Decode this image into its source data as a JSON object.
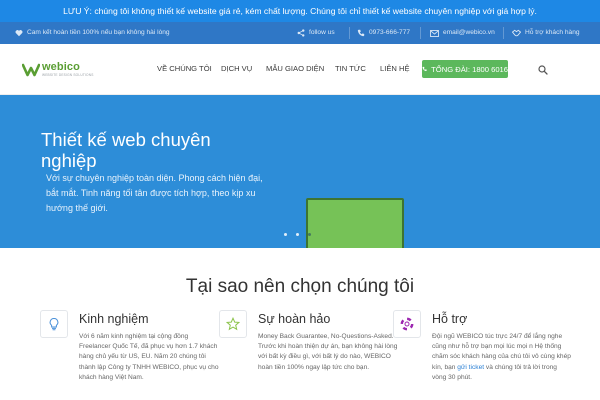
{
  "notice": {
    "text": "LƯU Ý: chúng tôi không thiết kế website giá rẻ, kém chất lượng. Chúng tôi chỉ thiết kế website chuyên nghiệp với giá hợp lý."
  },
  "topbar": {
    "promise": "Cam kết hoàn tiền 100% nếu bạn không hài lòng",
    "follow": "follow us",
    "phone": "0973-666-777",
    "email": "email@webico.vn",
    "support": "Hỗ trợ khách hàng"
  },
  "brand": {
    "name": "webico",
    "tagline": "WEBSITE DESIGN SOLUTIONS",
    "color": "#5a9e33"
  },
  "nav": {
    "items": [
      {
        "label": "VỀ CHÚNG TÔI"
      },
      {
        "label": "DỊCH VỤ"
      },
      {
        "label": "MẪU GIAO DIỆN"
      },
      {
        "label": "TIN TỨC"
      },
      {
        "label": "LIÊN HỆ"
      }
    ],
    "hotline": "TỔNG ĐÀI: 1800 6016",
    "hotline_color": "#5cb85c",
    "search_icon": "search-icon"
  },
  "hero": {
    "title": "Thiết kế web chuyên nghiệp",
    "subtitle": "Với sự chuyên nghiệp toàn diện. Phong cách hiện đại, bắt mắt. Tinh năng tối tân được tích hợp, theo kịp xu hướng thế giới.",
    "background": "#2d8dd8",
    "slides": 3,
    "active_slide": 1
  },
  "section": {
    "title": "Tại sao nên chọn chúng tôi",
    "features": [
      {
        "icon": "lightbulb-icon",
        "title": "Kinh nghiệm",
        "text": "Với 6 năm kinh nghiệm tại cộng đồng Freelancer Quốc Tế, đã phục vụ hơn 1.7 khách hàng chủ yếu từ US, EU. Năm 20 chúng tôi thành lập Công ty TNHH WEBICO, phục vụ cho khách hàng Việt Nam."
      },
      {
        "icon": "star-icon",
        "title": "Sự hoàn hảo",
        "text": "Money Back Guarantee, No-Questions-Asked. Trước khi hoàn thiện dự án, bạn không hài lòng với bất kỳ điều gì, với bất lý do nào, WEBICO hoàn tiền 100% ngay lập tức cho bạn."
      },
      {
        "icon": "lifebuoy-icon",
        "title": "Hỗ trợ",
        "text_before": "Đội ngũ WEBICO túc trực 24/7 để lắng nghe cũng như hỗ trợ bạn mọi lúc mọi n Hệ thống chăm sóc khách hàng của chú tôi vô cùng khép kín, bạn ",
        "link": "gửi ticket",
        "text_after": " và chúng tôi trả lời trong vòng 30 phút."
      }
    ]
  }
}
